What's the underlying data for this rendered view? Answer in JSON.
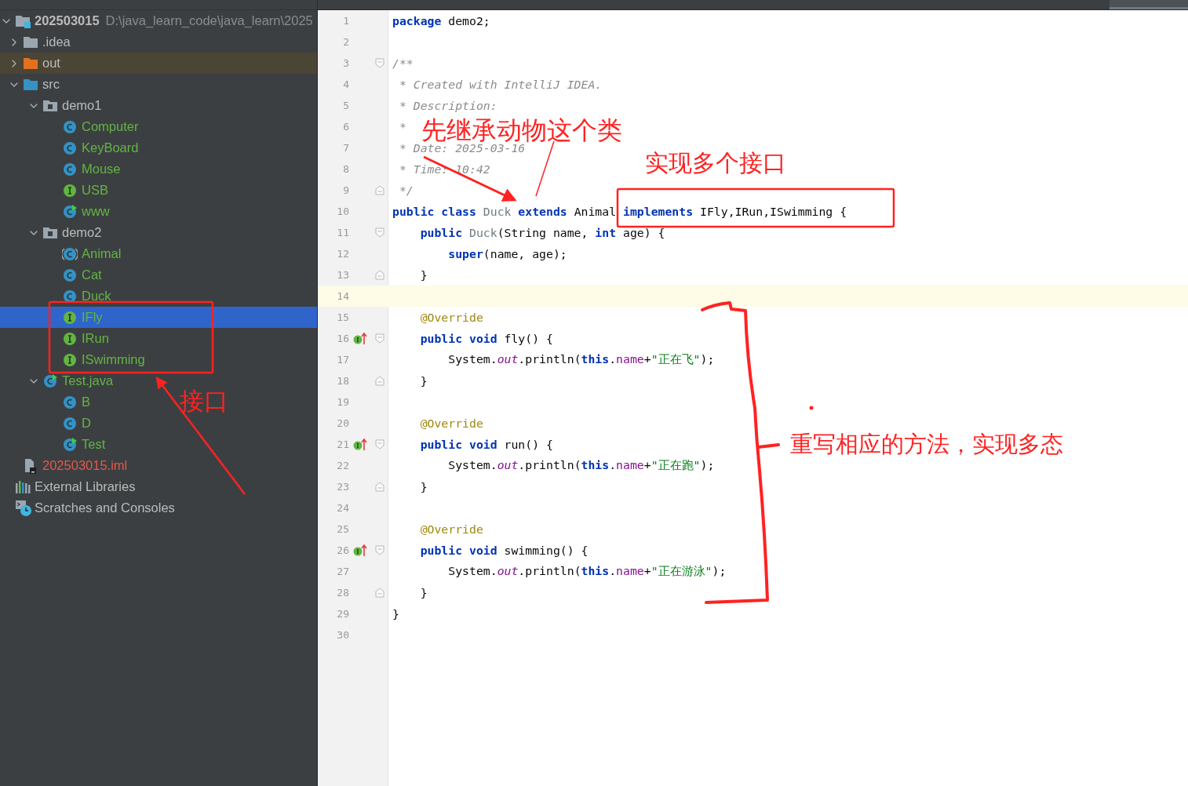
{
  "project_tree": [
    {
      "label": "202503015",
      "hint": "D:\\java_learn_code\\java_learn\\2025",
      "kind": "module",
      "color": "#bbbbbb",
      "selected": false,
      "expanded": true,
      "children": [
        {
          "label": ".idea",
          "kind": "folder",
          "color": "#bbbbbb",
          "selected": false,
          "expanded": false
        },
        {
          "label": "out",
          "kind": "excluded",
          "color": "#bbbbbb",
          "selected": false,
          "expanded": false
        },
        {
          "label": "src",
          "kind": "source",
          "color": "#bbbbbb",
          "selected": false,
          "expanded": true,
          "children": [
            {
              "label": "demo1",
              "kind": "package",
              "color": "#bbbbbb",
              "selected": false,
              "expanded": true,
              "children": [
                {
                  "label": "Computer",
                  "kind": "class",
                  "color": "#62b543",
                  "selected": false
                },
                {
                  "label": "KeyBoard",
                  "kind": "class",
                  "color": "#62b543",
                  "selected": false
                },
                {
                  "label": "Mouse",
                  "kind": "class",
                  "color": "#62b543",
                  "selected": false
                },
                {
                  "label": "USB",
                  "kind": "interface",
                  "color": "#62b543",
                  "selected": false
                },
                {
                  "label": "www",
                  "kind": "runnable",
                  "color": "#62b543",
                  "selected": false
                }
              ]
            },
            {
              "label": "demo2",
              "kind": "package",
              "color": "#bbbbbb",
              "selected": false,
              "expanded": true,
              "children": [
                {
                  "label": "Animal",
                  "kind": "abstract",
                  "color": "#62b543",
                  "selected": false
                },
                {
                  "label": "Cat",
                  "kind": "class",
                  "color": "#62b543",
                  "selected": false
                },
                {
                  "label": "Duck",
                  "kind": "class",
                  "color": "#62b543",
                  "selected": false
                },
                {
                  "label": "IFly",
                  "kind": "interface",
                  "color": "#62b543",
                  "selected": true
                },
                {
                  "label": "IRun",
                  "kind": "interface",
                  "color": "#62b543",
                  "selected": false
                },
                {
                  "label": "ISwimming",
                  "kind": "interface",
                  "color": "#62b543",
                  "selected": false
                }
              ]
            },
            {
              "label": "Test.java",
              "kind": "runnable",
              "color": "#62b543",
              "selected": false,
              "expanded": true,
              "children": [
                {
                  "label": "B",
                  "kind": "class",
                  "color": "#62b543",
                  "selected": false
                },
                {
                  "label": "D",
                  "kind": "class",
                  "color": "#62b543",
                  "selected": false
                },
                {
                  "label": "Test",
                  "kind": "runnable",
                  "color": "#62b543",
                  "selected": false
                }
              ]
            }
          ]
        },
        {
          "label": "202503015.iml",
          "kind": "iml",
          "color": "#e5574a",
          "selected": false
        }
      ]
    },
    {
      "label": "External Libraries",
      "kind": "libraries",
      "color": "#bbbbbb",
      "selected": false
    },
    {
      "label": "Scratches and Consoles",
      "kind": "scratches",
      "color": "#bbbbbb",
      "selected": false
    }
  ],
  "editor": {
    "lines": [
      {
        "number": "1",
        "tokens": [
          {
            "kind": "keyword",
            "t": "package"
          },
          {
            "kind": "plain",
            "t": " demo2;"
          }
        ]
      },
      {
        "number": "2"
      },
      {
        "number": "3",
        "fold_open": true,
        "tokens": [
          {
            "kind": "comment",
            "t": "/**"
          }
        ]
      },
      {
        "number": "4",
        "tokens": [
          {
            "kind": "comment",
            "t": " * Created with IntelliJ IDEA."
          }
        ]
      },
      {
        "number": "5",
        "tokens": [
          {
            "kind": "comment",
            "t": " * Description:"
          }
        ]
      },
      {
        "number": "6",
        "tokens": [
          {
            "kind": "comment",
            "t": " *"
          }
        ]
      },
      {
        "number": "7",
        "tokens": [
          {
            "kind": "comment",
            "t": " * Date: 2025-03-16"
          }
        ]
      },
      {
        "number": "8",
        "tokens": [
          {
            "kind": "comment",
            "t": " * Time: 10:42"
          }
        ]
      },
      {
        "number": "9",
        "fold_close": true,
        "tokens": [
          {
            "kind": "comment",
            "t": " */"
          }
        ]
      },
      {
        "number": "10",
        "tokens": [
          {
            "kind": "keyword",
            "t": "public class "
          },
          {
            "kind": "declaration",
            "t": "Duck"
          },
          {
            "kind": "keyword",
            "t": " extends "
          },
          {
            "kind": "plain",
            "t": "Animal "
          },
          {
            "kind": "keyword",
            "t": "implements "
          },
          {
            "kind": "plain",
            "t": "IFly,IRun,ISwimming {"
          }
        ]
      },
      {
        "number": "11",
        "fold_open": true,
        "tokens": [
          {
            "kind": "keyword",
            "t": "public "
          },
          {
            "kind": "declaration",
            "t": "Duck"
          },
          {
            "kind": "plain",
            "t": "(String name, "
          },
          {
            "kind": "keyword",
            "t": "int"
          },
          {
            "kind": "plain",
            "t": " age) {"
          }
        ]
      },
      {
        "number": "12",
        "tokens": [
          {
            "kind": "keyword",
            "t": "super"
          },
          {
            "kind": "plain",
            "t": "(name, age);"
          }
        ]
      },
      {
        "number": "13",
        "fold_close": true,
        "tokens": [
          {
            "kind": "plain",
            "t": "}"
          }
        ]
      },
      {
        "number": "14",
        "current": true
      },
      {
        "number": "15",
        "tokens": [
          {
            "kind": "annotation",
            "t": "@Override"
          }
        ]
      },
      {
        "number": "16",
        "implements": true,
        "fold_open": true,
        "tokens": [
          {
            "kind": "keyword",
            "t": "public void "
          },
          {
            "kind": "plain",
            "t": "fly() {"
          }
        ]
      },
      {
        "number": "17",
        "tokens": [
          {
            "kind": "plain",
            "t": "System."
          },
          {
            "kind": "static",
            "t": "out"
          },
          {
            "kind": "plain",
            "t": ".println("
          },
          {
            "kind": "keyword",
            "t": "this"
          },
          {
            "kind": "plain",
            "t": "."
          },
          {
            "kind": "field",
            "t": "name"
          },
          {
            "kind": "plain",
            "t": "+"
          },
          {
            "kind": "string",
            "t": "\"正在飞\""
          },
          {
            "kind": "plain",
            "t": ");"
          }
        ]
      },
      {
        "number": "18",
        "fold_close": true,
        "tokens": [
          {
            "kind": "plain",
            "t": "}"
          }
        ]
      },
      {
        "number": "19"
      },
      {
        "number": "20",
        "tokens": [
          {
            "kind": "annotation",
            "t": "@Override"
          }
        ]
      },
      {
        "number": "21",
        "implements": true,
        "fold_open": true,
        "tokens": [
          {
            "kind": "keyword",
            "t": "public void "
          },
          {
            "kind": "plain",
            "t": "run() {"
          }
        ]
      },
      {
        "number": "22",
        "tokens": [
          {
            "kind": "plain",
            "t": "System."
          },
          {
            "kind": "static",
            "t": "out"
          },
          {
            "kind": "plain",
            "t": ".println("
          },
          {
            "kind": "keyword",
            "t": "this"
          },
          {
            "kind": "plain",
            "t": "."
          },
          {
            "kind": "field",
            "t": "name"
          },
          {
            "kind": "plain",
            "t": "+"
          },
          {
            "kind": "string",
            "t": "\"正在跑\""
          },
          {
            "kind": "plain",
            "t": ");"
          }
        ]
      },
      {
        "number": "23",
        "fold_close": true,
        "tokens": [
          {
            "kind": "plain",
            "t": "}"
          }
        ]
      },
      {
        "number": "24"
      },
      {
        "number": "25",
        "tokens": [
          {
            "kind": "annotation",
            "t": "@Override"
          }
        ]
      },
      {
        "number": "26",
        "implements": true,
        "fold_open": true,
        "tokens": [
          {
            "kind": "keyword",
            "t": "public void "
          },
          {
            "kind": "plain",
            "t": "swimming() {"
          }
        ]
      },
      {
        "number": "27",
        "tokens": [
          {
            "kind": "plain",
            "t": "System."
          },
          {
            "kind": "static",
            "t": "out"
          },
          {
            "kind": "plain",
            "t": ".println("
          },
          {
            "kind": "keyword",
            "t": "this"
          },
          {
            "kind": "plain",
            "t": "."
          },
          {
            "kind": "field",
            "t": "name"
          },
          {
            "kind": "plain",
            "t": "+"
          },
          {
            "kind": "string",
            "t": "\"正在游泳\""
          },
          {
            "kind": "plain",
            "t": ");"
          }
        ]
      },
      {
        "number": "28",
        "fold_close": true,
        "tokens": [
          {
            "kind": "plain",
            "t": "}"
          }
        ]
      },
      {
        "number": "29",
        "tokens": [
          {
            "kind": "plain",
            "t": "}"
          }
        ]
      },
      {
        "number": "30"
      }
    ]
  },
  "annotations": [
    {
      "kind": "label",
      "text": "先继承动物这个类"
    },
    {
      "kind": "label",
      "text": "实现多个接口"
    },
    {
      "kind": "label",
      "text": "接口"
    },
    {
      "kind": "label",
      "text": "重写相应的方法，实现多态"
    }
  ]
}
